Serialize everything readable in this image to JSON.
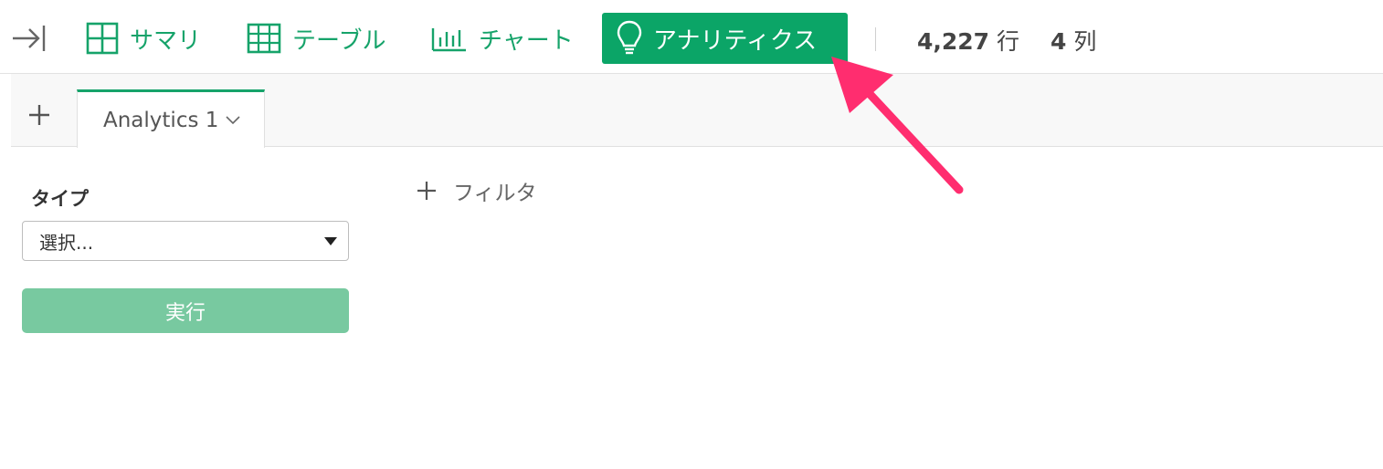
{
  "toolbar": {
    "summary_label": "サマリ",
    "table_label": "テーブル",
    "chart_label": "チャート",
    "analytics_label": "アナリティクス",
    "rows_count": "4,227",
    "rows_unit": "行",
    "cols_count": "4",
    "cols_unit": "列"
  },
  "tabs": [
    {
      "label": "Analytics 1",
      "active": true
    }
  ],
  "panel": {
    "type_label": "タイプ",
    "type_select_value": "選択...",
    "run_label": "実行",
    "filter_label": "フィルタ"
  },
  "colors": {
    "accent": "#16a36a",
    "analytics_active_bg": "#0ba567",
    "run_button_bg": "#78c9a0",
    "annotation_arrow": "#ff2d6f"
  },
  "icons": {
    "collapse": "collapse-right-icon",
    "summary": "grid-summary-icon",
    "table": "table-icon",
    "chart": "bar-chart-icon",
    "analytics": "lightbulb-icon",
    "add_tab": "plus-icon",
    "tab_menu": "chevron-down-icon",
    "type_select": "caret-down-icon",
    "filter": "plus-icon"
  }
}
